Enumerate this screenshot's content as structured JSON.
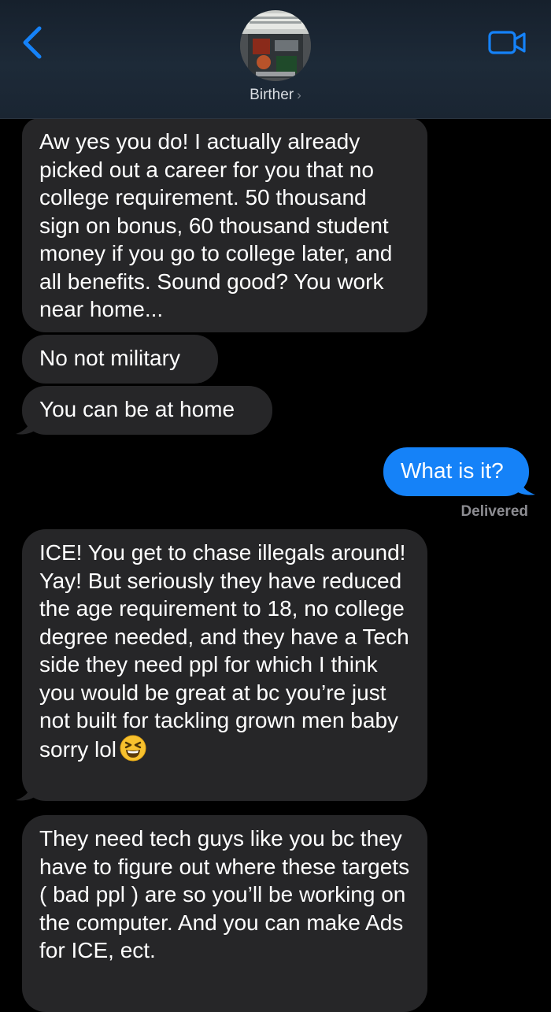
{
  "header": {
    "contact_name": "Birther",
    "back_icon": "chevron-left-icon",
    "video_icon": "video-camera-icon",
    "accent_color": "#1582f8"
  },
  "messages": [
    {
      "direction": "incoming",
      "text": "Aw yes you do! I actually already picked out a career for you that no college requirement. 50 thousand sign on bonus, 60 thousand student money if you go to college later, and all benefits. Sound good? You work near home..."
    },
    {
      "direction": "incoming",
      "text": "No not military"
    },
    {
      "direction": "incoming",
      "text": "You can be at home"
    },
    {
      "direction": "outgoing",
      "text": "What is it?",
      "status": "Delivered"
    },
    {
      "direction": "incoming",
      "text": "ICE! You get to chase illegals around! Yay! But seriously they have reduced the age requirement to 18, no college degree needed, and they have a Tech side they need ppl for which I think you would be great at bc you’re just not built for tackling grown men baby sorry lol",
      "emoji": "grinning-squinting-face-emoji"
    },
    {
      "direction": "incoming",
      "text": "They need tech guys like you bc they have to figure out where these targets ( bad ppl ) are so you’ll be working on the computer. And you can make Ads for ICE, ect."
    }
  ]
}
